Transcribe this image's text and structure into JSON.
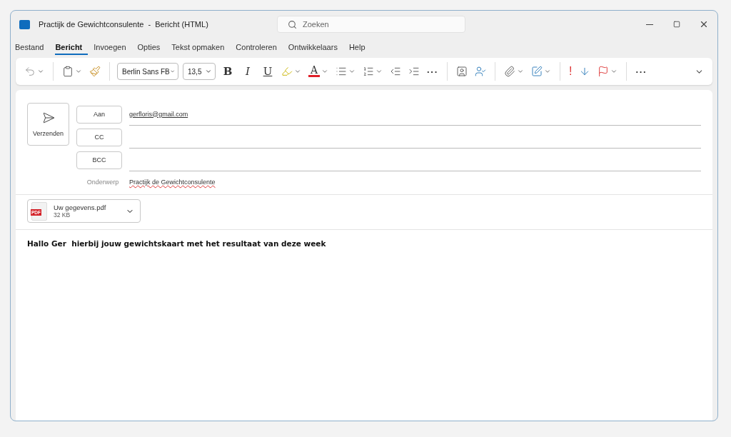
{
  "window": {
    "title": "Practijk de Gewichtconsulente  -  Bericht (HTML)"
  },
  "search": {
    "placeholder": "Zoeken"
  },
  "tabs": [
    {
      "label": "Bestand",
      "selected": false
    },
    {
      "label": "Bericht",
      "selected": true
    },
    {
      "label": "Invoegen",
      "selected": false
    },
    {
      "label": "Opties",
      "selected": false
    },
    {
      "label": "Tekst opmaken",
      "selected": false
    },
    {
      "label": "Controleren",
      "selected": false
    },
    {
      "label": "Ontwikkelaars",
      "selected": false
    },
    {
      "label": "Help",
      "selected": false
    }
  ],
  "toolbar": {
    "font": "Berlin Sans FB",
    "size": "13,5",
    "bold": "B",
    "italic": "I",
    "underline": "U",
    "font_color": "A",
    "more": "···",
    "more_end": "···",
    "importance": "!"
  },
  "send": {
    "label": "Verzenden"
  },
  "recipients": [
    {
      "label": "Aan",
      "value": "gerfloris@gmail.com"
    },
    {
      "label": "CC"
    },
    {
      "label": "BCC"
    }
  ],
  "subject": {
    "label": "Onderwerp",
    "value": "Practijk de Gewichtconsulente"
  },
  "attachment": {
    "name": "Uw gegevens.pdf",
    "size": "32 KB",
    "badge": "PDF"
  },
  "body": "Hallo Ger  hierbij jouw gewichtskaart met het resultaat van deze week"
}
